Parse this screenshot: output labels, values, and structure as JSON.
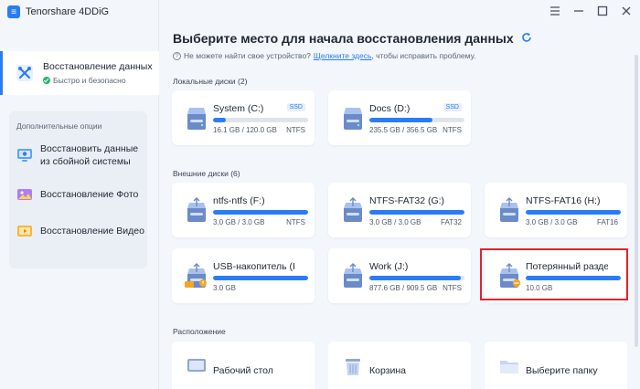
{
  "app": {
    "name": "Tenorshare 4DDiG"
  },
  "sidebar": {
    "primary": {
      "title": "Восстановление данных",
      "subtitle": "Быстро и безопасно"
    },
    "extra_title": "Дополнительные опции",
    "extra_items": [
      {
        "label_line1": "Восстановить данные",
        "label_line2": "из сбойной системы"
      },
      {
        "label_line1": "Восстановление Фото",
        "label_line2": ""
      },
      {
        "label_line1": "Восстановление Видео",
        "label_line2": ""
      }
    ]
  },
  "main": {
    "title": "Выберите место для начала восстановления данных",
    "hint_prefix": "Не можете найти свое устройство?",
    "hint_link": "Щелкните здесь",
    "hint_suffix": ", чтобы исправить проблему.",
    "local_section": "Локальные диски (2)",
    "external_section": "Внешние диски (6)",
    "location_section": "Расположение",
    "local_drives": [
      {
        "name": "System (C:)",
        "badge": "SSD",
        "size": "16.1 GB / 120.0 GB",
        "fs": "NTFS",
        "used": 0.13
      },
      {
        "name": "Docs (D:)",
        "badge": "SSD",
        "size": "235.5 GB / 356.5 GB",
        "fs": "NTFS",
        "used": 0.66
      }
    ],
    "external_drives": [
      {
        "name": "ntfs-ntfs (F:)",
        "size": "3.0 GB / 3.0 GB",
        "fs": "NTFS",
        "used": 1.0
      },
      {
        "name": "NTFS-FAT32 (G:)",
        "size": "3.0 GB / 3.0 GB",
        "fs": "FAT32",
        "used": 1.0
      },
      {
        "name": "NTFS-FAT16 (H:)",
        "size": "3.0 GB / 3.0 GB",
        "fs": "FAT16",
        "used": 1.0
      },
      {
        "name": "USB-накопитель (I:)",
        "size": "3.0 GB",
        "fs": "",
        "used": 1.0
      },
      {
        "name": "Work (J:)",
        "size": "877.6 GB / 909.5 GB",
        "fs": "NTFS",
        "used": 0.96
      },
      {
        "name": "Потерянный разде...",
        "size": "10.0 GB",
        "fs": "",
        "used": 1.0
      }
    ],
    "locations": [
      {
        "label": "Рабочий стол"
      },
      {
        "label": "Корзина"
      },
      {
        "label": "Выберите папку"
      }
    ]
  },
  "colors": {
    "accent": "#2a7cf6",
    "highlight": "#e0242b",
    "status_ok": "#21b56a",
    "warning": "#f5a623"
  }
}
